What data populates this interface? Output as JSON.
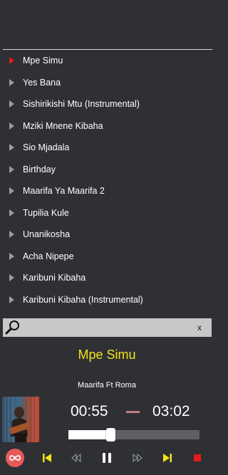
{
  "playlist": {
    "items": [
      {
        "label": "Mpe Simu",
        "active": true
      },
      {
        "label": "Yes Bana",
        "active": false
      },
      {
        "label": "Sishirikishi Mtu (Instrumental)",
        "active": false
      },
      {
        "label": "Mziki Mnene Kibaha",
        "active": false
      },
      {
        "label": "Sio Mjadala",
        "active": false
      },
      {
        "label": "Birthday",
        "active": false
      },
      {
        "label": "Maarifa Ya Maarifa 2",
        "active": false
      },
      {
        "label": "Tupilia Kule",
        "active": false
      },
      {
        "label": "Unanikosha",
        "active": false
      },
      {
        "label": "Acha Nipepe",
        "active": false
      },
      {
        "label": "Karibuni Kibaha",
        "active": false
      },
      {
        "label": "Karibuni Kibaha (Instrumental)",
        "active": false
      }
    ]
  },
  "search": {
    "value": "",
    "clear_label": "x"
  },
  "now_playing": {
    "title": "Mpe Simu",
    "artist": "Maarifa Ft Roma",
    "current_time": "00:55",
    "total_time": "03:02",
    "progress": 0.32
  },
  "colors": {
    "background": "#2f3034",
    "title": "#f2e31a",
    "active_marker": "#e31b1b",
    "accent_yellow": "#f2e31a",
    "stop_red": "#e31b1b",
    "repeat_bg": "#e85a5a"
  },
  "controls": {
    "icons": [
      "repeat-infinity-icon",
      "skip-previous-icon",
      "rewind-icon",
      "pause-icon",
      "fast-forward-icon",
      "skip-next-icon",
      "stop-icon"
    ]
  }
}
